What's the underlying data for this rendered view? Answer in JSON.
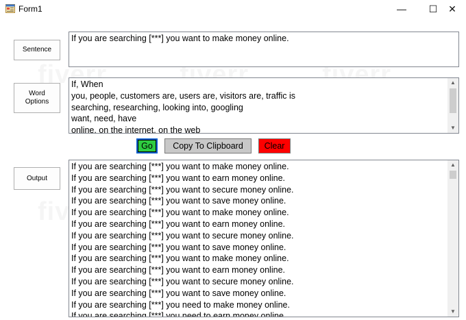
{
  "window": {
    "title": "Form1",
    "min_glyph": "—",
    "max_glyph": "☐",
    "close_glyph": "✕"
  },
  "buttons": {
    "sentence": "Sentence",
    "word_options": "Word Options",
    "output": "Output",
    "go": "Go",
    "copy": "Copy To Clipboard",
    "clear": "Clear"
  },
  "colors": {
    "go": "#2ecc40",
    "copy": "#c8c8c8",
    "clear": "#ff0000"
  },
  "sentence_text": "If you are searching [***] you want to make money online.",
  "word_options_lines": [
    "If, When",
    "you, people, customers are, users are, visitors are, traffic is",
    "searching, researching, looking into, googling",
    "want, need, have",
    "online, on the internet, on the web"
  ],
  "output_lines": [
    "If you are searching [***] you want to make money online.",
    "If you are searching [***] you want to earn money online.",
    "If you are searching [***] you want to secure money online.",
    "If you are searching [***] you want to save money online.",
    "If you are searching [***] you want to make money online.",
    "If you are searching [***] you want to earn money online.",
    "If you are searching [***] you want to secure money online.",
    "If you are searching [***] you want to save money online.",
    "If you are searching [***] you want to make money online.",
    "If you are searching [***] you want to earn money online.",
    "If you are searching [***] you want to secure money online.",
    "If you are searching [***] you want to save money online.",
    "If you are searching [***] you need to make money online.",
    "If you are searching [***] you need to earn money online."
  ],
  "icons": {
    "app": "form-app-icon",
    "scroll_up": "▲",
    "scroll_down": "▼"
  },
  "watermark": "fiverr."
}
